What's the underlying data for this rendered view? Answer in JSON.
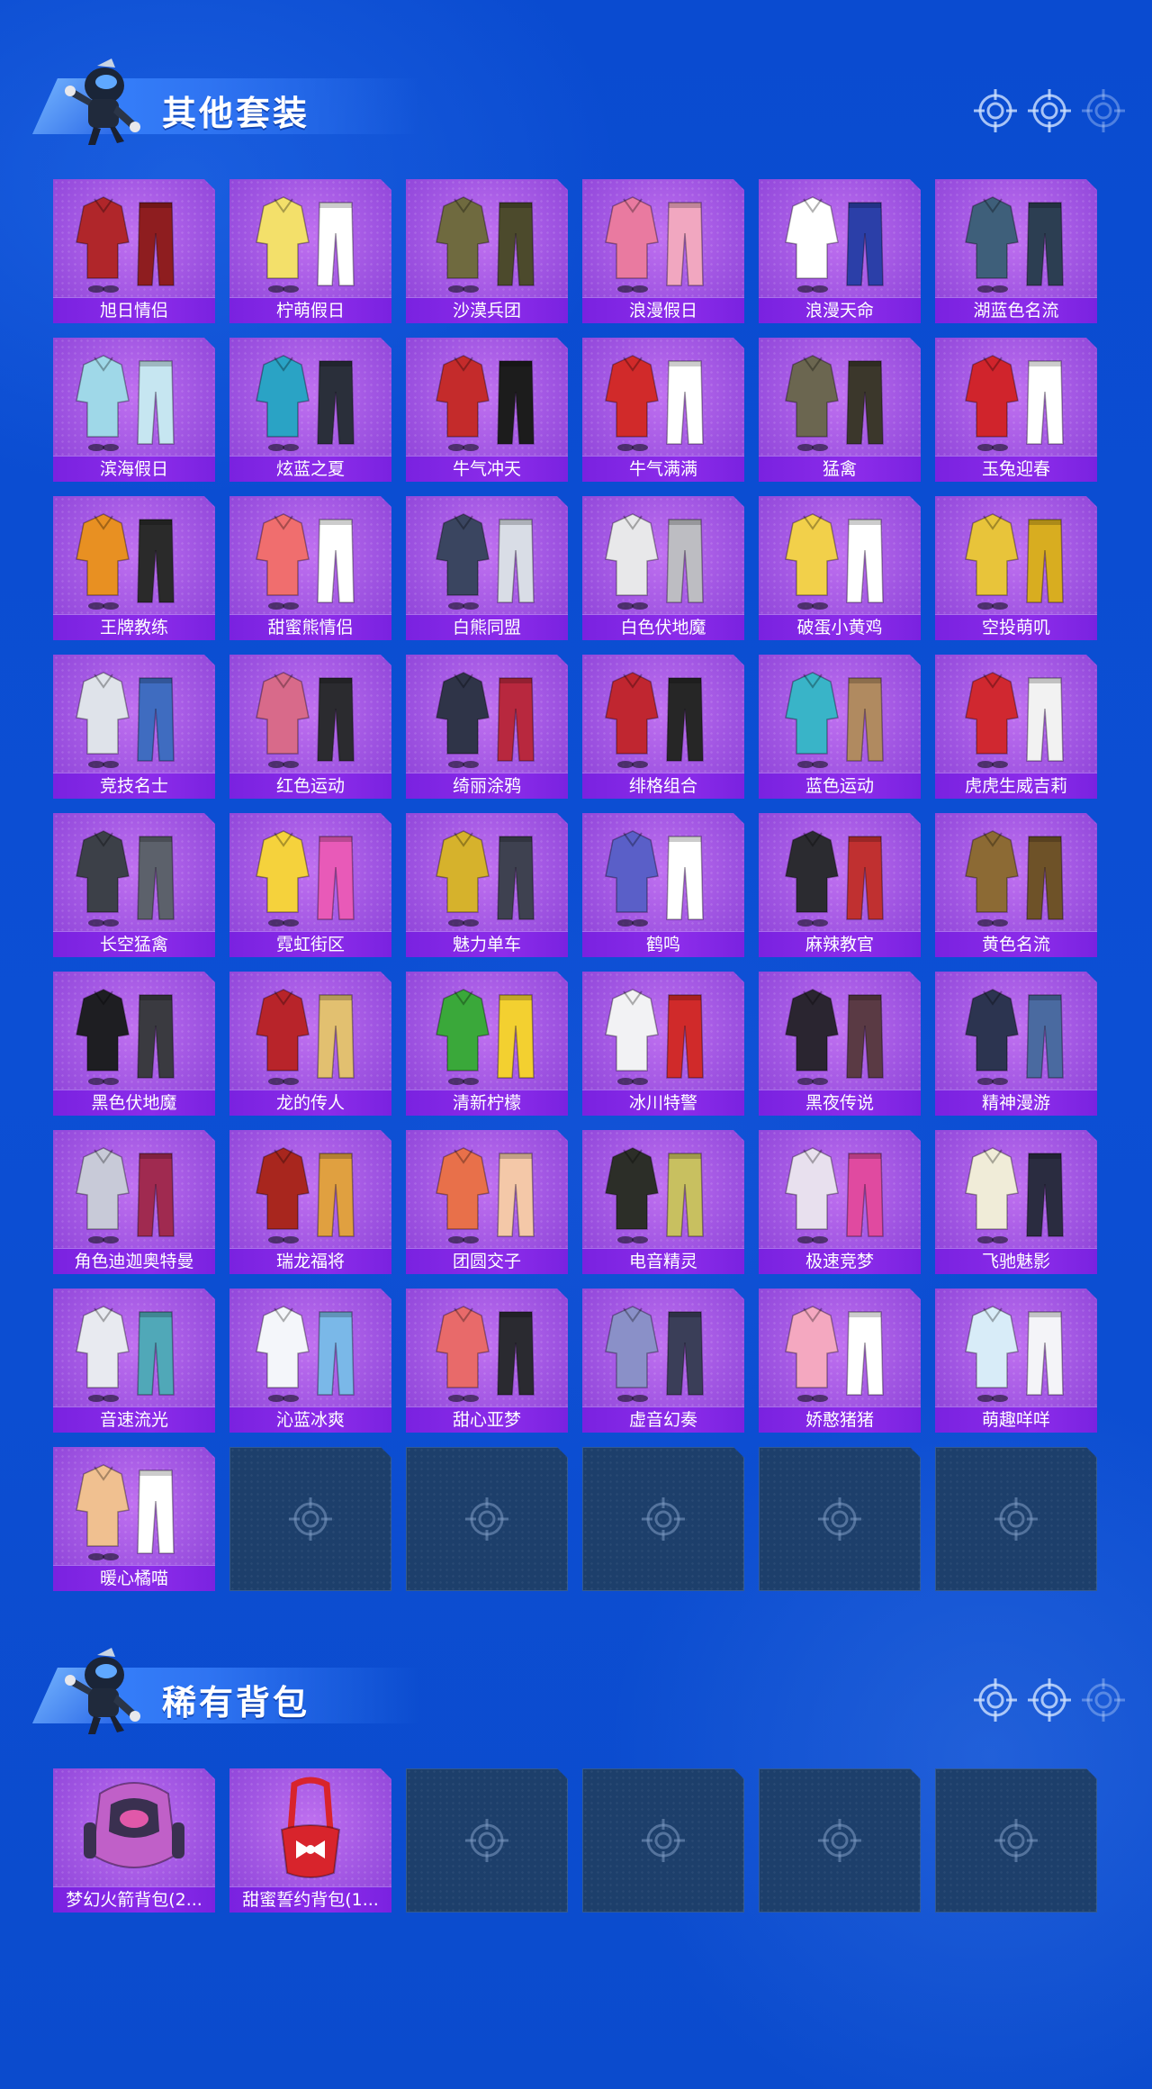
{
  "sections": [
    {
      "title": "其他套装",
      "icon": "skydiver-character-icon",
      "items": [
        {
          "name": "旭日情侣",
          "palette": [
            "#b0262a",
            "#8e1d1f"
          ]
        },
        {
          "name": "柠萌假日",
          "palette": [
            "#f3e06a",
            "#ffffff"
          ]
        },
        {
          "name": "沙漠兵团",
          "palette": [
            "#6f6a3f",
            "#4c4a2c"
          ]
        },
        {
          "name": "浪漫假日",
          "palette": [
            "#e97aa0",
            "#f1a7c0"
          ]
        },
        {
          "name": "浪漫天命",
          "palette": [
            "#ffffff",
            "#2b3fa8"
          ]
        },
        {
          "name": "湖蓝色名流",
          "palette": [
            "#3e5f7a",
            "#2c3e52"
          ]
        },
        {
          "name": "滨海假日",
          "palette": [
            "#9fd8e8",
            "#c6e6f1"
          ]
        },
        {
          "name": "炫蓝之夏",
          "palette": [
            "#2aa3c5",
            "#2a2f3a"
          ]
        },
        {
          "name": "牛气冲天",
          "palette": [
            "#c42b2b",
            "#1c1c1c"
          ]
        },
        {
          "name": "牛气满满",
          "palette": [
            "#d12a2a",
            "#ffffff"
          ]
        },
        {
          "name": "猛禽",
          "palette": [
            "#6b6650",
            "#3b372b"
          ]
        },
        {
          "name": "玉兔迎春",
          "palette": [
            "#d0242c",
            "#ffffff"
          ]
        },
        {
          "name": "王牌教练",
          "palette": [
            "#e89022",
            "#2a2a2a"
          ]
        },
        {
          "name": "甜蜜熊情侣",
          "palette": [
            "#f06e6e",
            "#ffffff"
          ]
        },
        {
          "name": "白熊同盟",
          "palette": [
            "#3a4560",
            "#d9dde6"
          ]
        },
        {
          "name": "白色伏地魔",
          "palette": [
            "#e8e8ea",
            "#bdbdc2"
          ]
        },
        {
          "name": "破蛋小黄鸡",
          "palette": [
            "#f2d04a",
            "#ffffff"
          ]
        },
        {
          "name": "空投萌叽",
          "palette": [
            "#e8c43a",
            "#d8ad20"
          ]
        },
        {
          "name": "竞技名士",
          "palette": [
            "#dfe3ea",
            "#3f6cc0"
          ]
        },
        {
          "name": "红色运动",
          "palette": [
            "#d86a8a",
            "#2b2b2f"
          ]
        },
        {
          "name": "绮丽涂鸦",
          "palette": [
            "#2f3448",
            "#b8283e"
          ]
        },
        {
          "name": "绯格组合",
          "palette": [
            "#c02630",
            "#262626"
          ]
        },
        {
          "name": "蓝色运动",
          "palette": [
            "#39b4c8",
            "#b08a60"
          ]
        },
        {
          "name": "虎虎生威吉莉",
          "palette": [
            "#d02830",
            "#f2f2f2"
          ]
        },
        {
          "name": "长空猛禽",
          "palette": [
            "#3c4048",
            "#5c616b"
          ]
        },
        {
          "name": "霓虹街区",
          "palette": [
            "#f5d23c",
            "#e85ab8"
          ]
        },
        {
          "name": "魅力单车",
          "palette": [
            "#d6b22c",
            "#3e4150"
          ]
        },
        {
          "name": "鹤鸣",
          "palette": [
            "#5a5fc8",
            "#ffffff"
          ]
        },
        {
          "name": "麻辣教官",
          "palette": [
            "#2b2b30",
            "#c03030"
          ]
        },
        {
          "name": "黄色名流",
          "palette": [
            "#8c6a34",
            "#6e5228"
          ]
        },
        {
          "name": "黑色伏地魔",
          "palette": [
            "#1e1e22",
            "#3a3a40"
          ]
        },
        {
          "name": "龙的传人",
          "palette": [
            "#b8242a",
            "#e2c070"
          ]
        },
        {
          "name": "清新柠檬",
          "palette": [
            "#3aa83a",
            "#f3d030"
          ]
        },
        {
          "name": "冰川特警",
          "palette": [
            "#f2f2f4",
            "#d02a2a"
          ]
        },
        {
          "name": "黑夜传说",
          "palette": [
            "#2a2530",
            "#5a3a44"
          ]
        },
        {
          "name": "精神漫游",
          "palette": [
            "#2c3450",
            "#4a6aa0"
          ]
        },
        {
          "name": "角色迪迦奥特曼",
          "palette": [
            "#c8cad8",
            "#a02a50"
          ]
        },
        {
          "name": "瑞龙福将",
          "palette": [
            "#a8261e",
            "#e0a040"
          ]
        },
        {
          "name": "团圆交子",
          "palette": [
            "#e8704a",
            "#f4c8a8"
          ]
        },
        {
          "name": "电音精灵",
          "palette": [
            "#2c2e28",
            "#c8c060"
          ]
        },
        {
          "name": "极速竞梦",
          "palette": [
            "#e8e0ee",
            "#e04aa0"
          ]
        },
        {
          "name": "飞驰魅影",
          "palette": [
            "#f0ecd8",
            "#2a2c40"
          ]
        },
        {
          "name": "音速流光",
          "palette": [
            "#e8eaf0",
            "#50a8b8"
          ]
        },
        {
          "name": "沁蓝冰爽",
          "palette": [
            "#f4f6fa",
            "#7ab8e8"
          ]
        },
        {
          "name": "甜心亚梦",
          "palette": [
            "#e86a6a",
            "#2a2a30"
          ]
        },
        {
          "name": "虚音幻奏",
          "palette": [
            "#8a90c8",
            "#3a3e58"
          ]
        },
        {
          "name": "娇憨猪猪",
          "palette": [
            "#f4a8c0",
            "#ffffff"
          ]
        },
        {
          "name": "萌趣咩咩",
          "palette": [
            "#d8ecf8",
            "#f4f4f8"
          ]
        },
        {
          "name": "暖心橘喵",
          "palette": [
            "#f0c090",
            "#ffffff"
          ]
        }
      ],
      "empty_slots": 5
    },
    {
      "title": "稀有背包",
      "icon": "skydiver-character-icon",
      "items": [
        {
          "name": "梦幻火箭背包(2...",
          "palette": [
            "#c060c8",
            "#3a3050"
          ]
        },
        {
          "name": "甜蜜誓约背包(1...",
          "palette": [
            "#d8242c",
            "#ffffff"
          ]
        }
      ],
      "empty_slots": 4
    }
  ],
  "icons": {
    "empty_slot": "crosshair-icon",
    "header_deco": [
      "crosshair-icon",
      "crosshair-icon",
      "crosshair-icon"
    ]
  },
  "colors": {
    "background": "#0c4fd0",
    "card_fill": "#a055e2",
    "label_bar": "#8c2cea",
    "empty_slot": "#1d3f6b",
    "banner": "#2f74f2"
  }
}
